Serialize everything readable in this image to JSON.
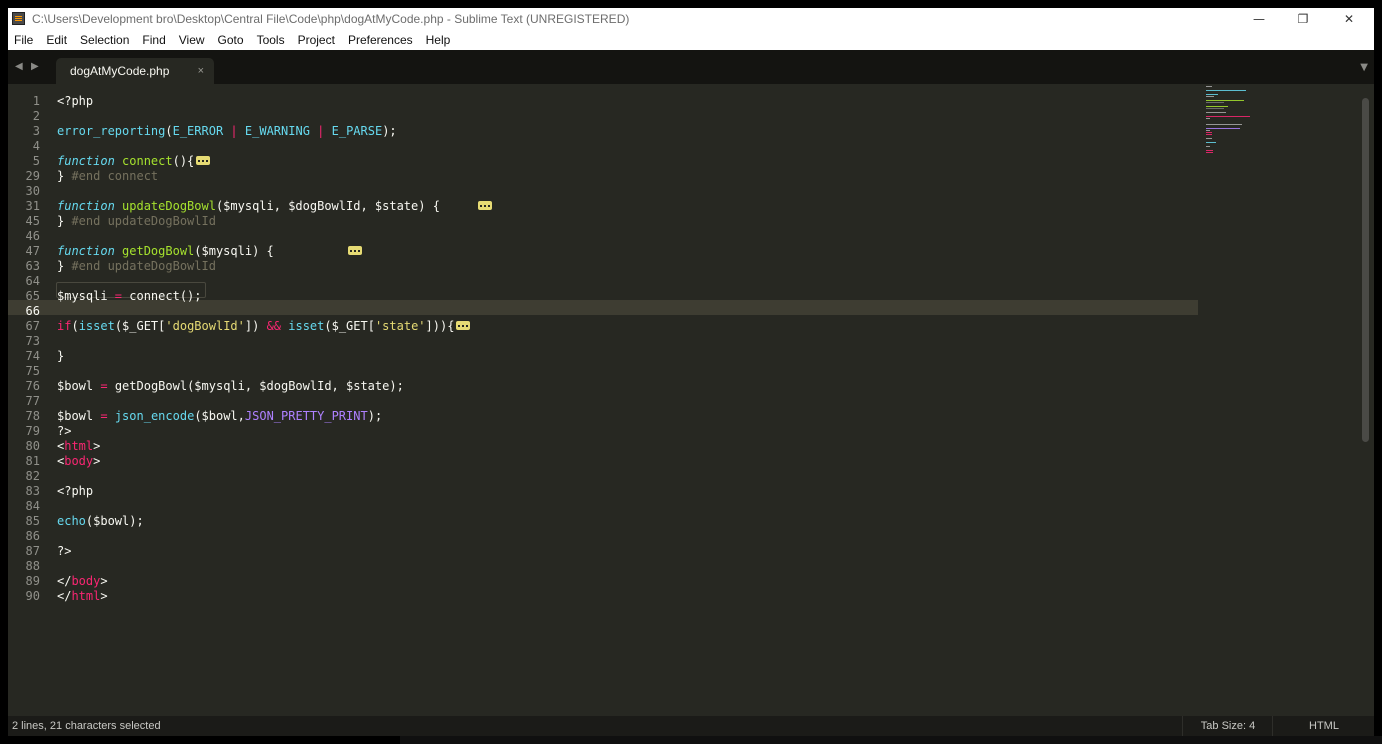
{
  "window": {
    "title": "C:\\Users\\Development bro\\Desktop\\Central File\\Code\\php\\dogAtMyCode.php - Sublime Text (UNREGISTERED)",
    "app_icon": "sublime-text-icon",
    "controls": {
      "minimize": "—",
      "restore": "❐",
      "close": "✕"
    }
  },
  "menu": [
    "File",
    "Edit",
    "Selection",
    "Find",
    "View",
    "Goto",
    "Tools",
    "Project",
    "Preferences",
    "Help"
  ],
  "tabbar": {
    "back": "◀",
    "forward": "▶",
    "tabs": [
      {
        "label": "dogAtMyCode.php",
        "close": "×",
        "active": true
      }
    ],
    "dropdown": "▼"
  },
  "editor": {
    "line_numbers": [
      "1",
      "2",
      "3",
      "4",
      "5",
      "29",
      "30",
      "31",
      "45",
      "46",
      "47",
      "63",
      "64",
      "65",
      "66",
      "67",
      "73",
      "74",
      "75",
      "76",
      "77",
      "78",
      "79",
      "80",
      "81",
      "82",
      "83",
      "84",
      "85",
      "86",
      "87",
      "88",
      "89",
      "90"
    ],
    "current_line": "66",
    "selected_text": "$mysqli = connect();",
    "fold_marker": "…"
  },
  "statusbar": {
    "selection": "2 lines, 21 characters selected",
    "tab_size": "Tab Size: 4",
    "syntax": "HTML"
  },
  "colors": {
    "background": "#272822",
    "keyword": "#f92672",
    "function": "#66d9ef",
    "entity": "#a6e22e",
    "string": "#e6db74",
    "constant": "#ae81ff",
    "comment": "#75715e"
  }
}
